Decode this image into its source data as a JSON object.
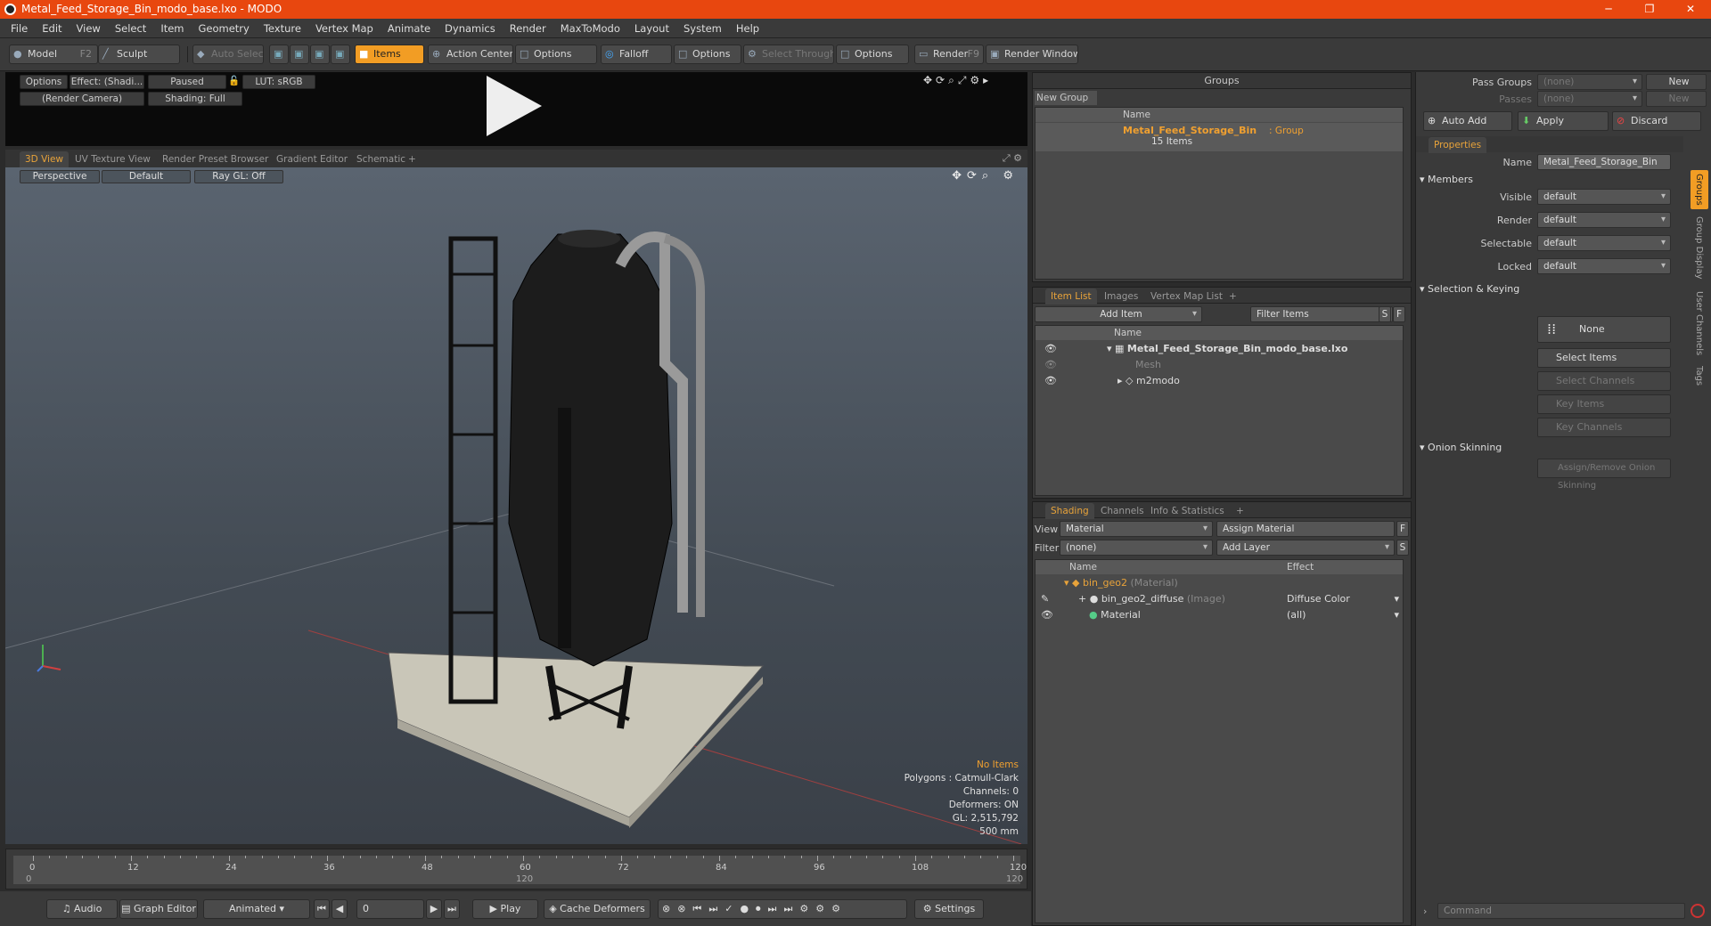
{
  "window": {
    "title": "Metal_Feed_Storage_Bin_modo_base.lxo - MODO"
  },
  "menu": [
    "File",
    "Edit",
    "View",
    "Select",
    "Item",
    "Geometry",
    "Texture",
    "Vertex Map",
    "Animate",
    "Dynamics",
    "Render",
    "MaxToModo",
    "Layout",
    "System",
    "Help"
  ],
  "toolbar": {
    "model": "Model",
    "model_key": "F2",
    "sculpt": "Sculpt",
    "auto_select": "Auto Select",
    "items": "Items",
    "action_center": "Action Center",
    "options1": "Options",
    "falloff": "Falloff",
    "options2": "Options",
    "select_through": "Select Through",
    "options3": "Options",
    "render": "Render",
    "render_key": "F9",
    "render_window": "Render Window"
  },
  "preview": {
    "options": "Options",
    "effect": "Effect: (Shadi...",
    "paused": "Paused",
    "lut": "LUT: sRGB",
    "camera": "(Render Camera)",
    "shading": "Shading: Full"
  },
  "viewport_tabs": [
    "3D View",
    "UV Texture View",
    "Render Preset Browser",
    "Gradient Editor",
    "Schematic",
    "+"
  ],
  "viewport": {
    "perspective": "Perspective",
    "default": "Default",
    "raygl": "Ray GL: Off",
    "stats": {
      "no_items": "No Items",
      "polygons": "Polygons : Catmull-Clark",
      "channels": "Channels: 0",
      "deformers": "Deformers: ON",
      "gl": "GL: 2,515,792",
      "size": "500 mm"
    }
  },
  "timeline": {
    "ticks": [
      "0",
      "12",
      "24",
      "36",
      "48",
      "60",
      "72",
      "84",
      "96",
      "108",
      "120"
    ],
    "start": "0",
    "mid": "120",
    "end": "120"
  },
  "transport": {
    "audio": "Audio",
    "graph_editor": "Graph Editor",
    "animated": "Animated",
    "frame": "0",
    "play": "Play",
    "cache": "Cache Deformers",
    "settings": "Settings"
  },
  "groups": {
    "title": "Groups",
    "new_group": "New Group",
    "col_name": "Name",
    "item_name": "Metal_Feed_Storage_Bin",
    "item_type": ": Group",
    "item_count": "15 Items"
  },
  "item_list": {
    "tabs": [
      "Item List",
      "Images",
      "Vertex Map List",
      "+"
    ],
    "add_item": "Add Item",
    "filter": "Filter Items",
    "s": "S",
    "f": "F",
    "col_name": "Name",
    "rows": [
      "Metal_Feed_Storage_Bin_modo_base.lxo",
      "Mesh",
      "m2modo"
    ]
  },
  "shading": {
    "tabs": [
      "Shading",
      "Channels",
      "Info & Statistics",
      "+"
    ],
    "view_label": "View",
    "view_value": "Material",
    "assign": "Assign Material",
    "filter_label": "Filter",
    "filter_value": "(none)",
    "add_layer": "Add Layer",
    "f": "F",
    "s": "S",
    "col_name": "Name",
    "col_effect": "Effect",
    "rows": [
      {
        "name": "bin_geo2",
        "suffix": "(Material)",
        "effect": ""
      },
      {
        "name": "bin_geo2_diffuse",
        "suffix": "(Image)",
        "effect": "Diffuse Color"
      },
      {
        "name": "Material",
        "suffix": "",
        "effect": "(all)"
      }
    ]
  },
  "right": {
    "pass_groups": "Pass Groups",
    "passes": "Passes",
    "none1": "(none)",
    "none2": "(none)",
    "new1": "New",
    "new2": "New",
    "auto_add": "Auto Add",
    "apply": "Apply",
    "discard": "Discard",
    "properties": "Properties",
    "name_label": "Name",
    "name_value": "Metal_Feed_Storage_Bin",
    "members": "Members",
    "visible": "Visible",
    "render": "Render",
    "selectable": "Selectable",
    "locked": "Locked",
    "default": "default",
    "sel_keying": "Selection & Keying",
    "none": "None",
    "select_items": "Select Items",
    "select_channels": "Select Channels",
    "key_items": "Key Items",
    "key_channels": "Key Channels",
    "onion": "Onion Skinning",
    "assign_onion": "Assign/Remove Onion Skinning",
    "side_tabs": [
      "Groups",
      "Group Display",
      "User Channels",
      "Tags"
    ],
    "command": "Command"
  }
}
